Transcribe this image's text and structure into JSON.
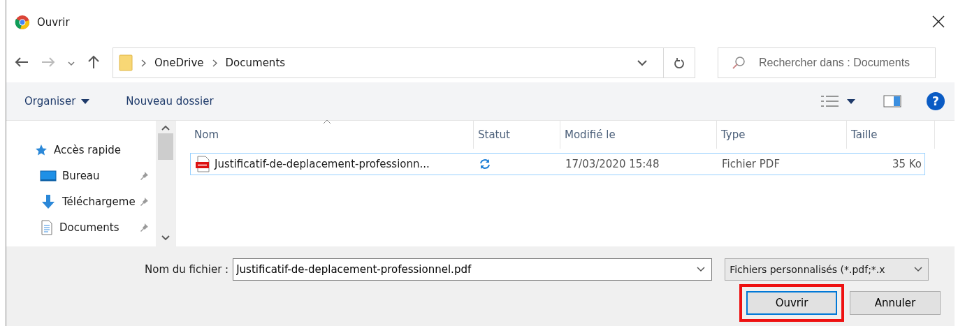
{
  "window": {
    "title": "Ouvrir"
  },
  "address_bar": {
    "path": [
      "OneDrive",
      "Documents"
    ]
  },
  "search": {
    "placeholder": "Rechercher dans : Documents"
  },
  "toolbar": {
    "organize": "Organiser",
    "new_folder": "Nouveau dossier",
    "help": "?"
  },
  "sidebar": {
    "items": [
      {
        "label": "Accès rapide",
        "kind": "star",
        "pinned": false
      },
      {
        "label": "Bureau",
        "kind": "desktop",
        "pinned": true
      },
      {
        "label": "Téléchargeme",
        "kind": "download",
        "pinned": true
      },
      {
        "label": "Documents",
        "kind": "documents",
        "pinned": true
      }
    ]
  },
  "table": {
    "columns": [
      "Nom",
      "Statut",
      "Modifié le",
      "Type",
      "Taille"
    ],
    "rows": [
      {
        "name": "Justificatif-de-deplacement-professionn...",
        "modified": "17/03/2020 15:48",
        "type": "Fichier PDF",
        "size": "35 Ko",
        "selected": true
      }
    ]
  },
  "footer": {
    "file_name_label": "Nom du fichier :",
    "file_name": "Justificatif-de-deplacement-professionnel.pdf",
    "file_type": "Fichiers personnalisés (*.pdf;*.x",
    "buttons": [
      {
        "label": "Ouvrir",
        "highlighted": true
      },
      {
        "label": "Annuler",
        "highlighted": false
      }
    ]
  }
}
